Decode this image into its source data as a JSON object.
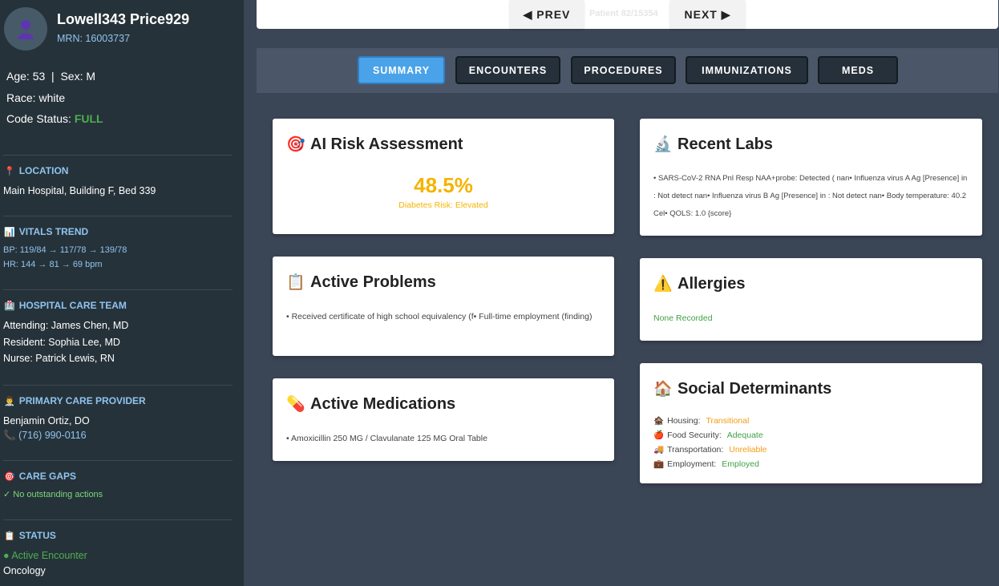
{
  "patient": {
    "name": "Lowell343 Price929",
    "mrn": "MRN: 16003737",
    "age_sex": "Age: 53  |  Sex: M",
    "race": "Race: white",
    "code_status_label": "Code Status: ",
    "code_status_value": "FULL"
  },
  "location": {
    "title": "LOCATION",
    "icon": "pin-icon",
    "text": "Main Hospital, Building F, Bed 339"
  },
  "vitals": {
    "title": "VITALS TREND",
    "icon": "chart-icon",
    "bp": "BP: 119/84 → 117/78 → 139/78",
    "hr": "HR: 144 → 81 → 69 bpm"
  },
  "care_team": {
    "title": "HOSPITAL CARE TEAM",
    "icon": "hospital-icon",
    "attending": "Attending: James Chen, MD",
    "resident": "Resident: Sophia Lee, MD",
    "nurse": "Nurse: Patrick Lewis, RN"
  },
  "pcp": {
    "title": "PRIMARY CARE PROVIDER",
    "icon": "doctor-icon",
    "name": "Benjamin Ortiz, DO",
    "phone": "(716) 990-0116"
  },
  "care_gaps": {
    "title": "CARE GAPS",
    "icon": "target-icon",
    "text": "✓ No outstanding actions"
  },
  "status": {
    "title": "STATUS",
    "icon": "clipboard-icon",
    "encounter": "● Active Encounter",
    "department": "Oncology"
  },
  "nav": {
    "prev": "◀ PREV",
    "next": "NEXT ▶",
    "counter": "Patient 82/15354"
  },
  "tabs": [
    {
      "label": "SUMMARY",
      "active": true
    },
    {
      "label": "ENCOUNTERS",
      "active": false
    },
    {
      "label": "PROCEDURES",
      "active": false
    },
    {
      "label": "IMMUNIZATIONS",
      "active": false
    },
    {
      "label": "MEDS",
      "active": false
    }
  ],
  "cards": {
    "risk": {
      "title": "AI Risk Assessment",
      "icon": "target-icon",
      "value": "48.5%",
      "label": "Diabetes Risk: Elevated",
      "color": "#f4b400"
    },
    "labs": {
      "title": "Recent Labs",
      "icon": "microscope-icon",
      "text": "• SARS-CoV-2 RNA Pnl Resp NAA+probe: Detected ( nan• Influenza virus A Ag [Presence] in : Not detect nan• Influenza virus B Ag [Presence] in : Not detect nan• Body temperature: 40.2 Cel• QOLS: 1.0 {score}"
    },
    "problems": {
      "title": "Active Problems",
      "icon": "clipboard-icon",
      "text": "• Received certificate of high school equivalency (f• Full-time employment (finding)"
    },
    "allergies": {
      "title": "Allergies",
      "icon": "warning-icon",
      "text": "None Recorded"
    },
    "meds": {
      "title": "Active Medications",
      "icon": "pill-icon",
      "text": "• Amoxicillin 250 MG / Clavulanate 125 MG Oral Table"
    },
    "social": {
      "title": "Social Determinants",
      "icon": "house-icon",
      "housing_label": "Housing: ",
      "housing_value": "Transitional",
      "food_label": "Food Security: ",
      "food_value": "Adequate",
      "transport_label": "Transportation: ",
      "transport_value": "Unreliable",
      "employment_label": "Employment: ",
      "employment_value": "Employed"
    }
  }
}
